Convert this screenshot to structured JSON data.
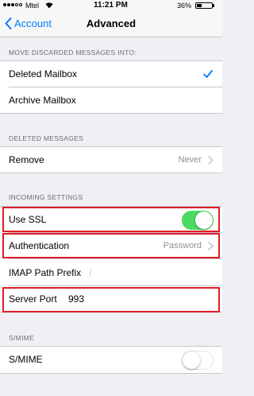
{
  "status_bar": {
    "carrier": "Mtel",
    "time": "11:21 PM",
    "battery": "36%",
    "battery_level": 0.36
  },
  "nav": {
    "back_label": "Account",
    "title": "Advanced"
  },
  "move_discarded": {
    "header": "MOVE DISCARDED MESSAGES INTO:",
    "items": [
      {
        "label": "Deleted Mailbox",
        "selected": true
      },
      {
        "label": "Archive Mailbox",
        "selected": false
      }
    ]
  },
  "deleted_messages": {
    "header": "DELETED MESSAGES",
    "remove_label": "Remove",
    "remove_value": "Never"
  },
  "incoming": {
    "header": "INCOMING SETTINGS",
    "use_ssl_label": "Use SSL",
    "use_ssl_on": true,
    "auth_label": "Authentication",
    "auth_value": "Password",
    "imap_prefix_label": "IMAP Path Prefix",
    "imap_prefix_value": "/",
    "server_port_label": "Server Port",
    "server_port_value": "993"
  },
  "smime": {
    "header": "S/MIME",
    "label": "S/MIME",
    "on": false
  },
  "colors": {
    "accent": "#007aff",
    "toggle_on": "#4cd964",
    "highlight": "#e01b24"
  }
}
